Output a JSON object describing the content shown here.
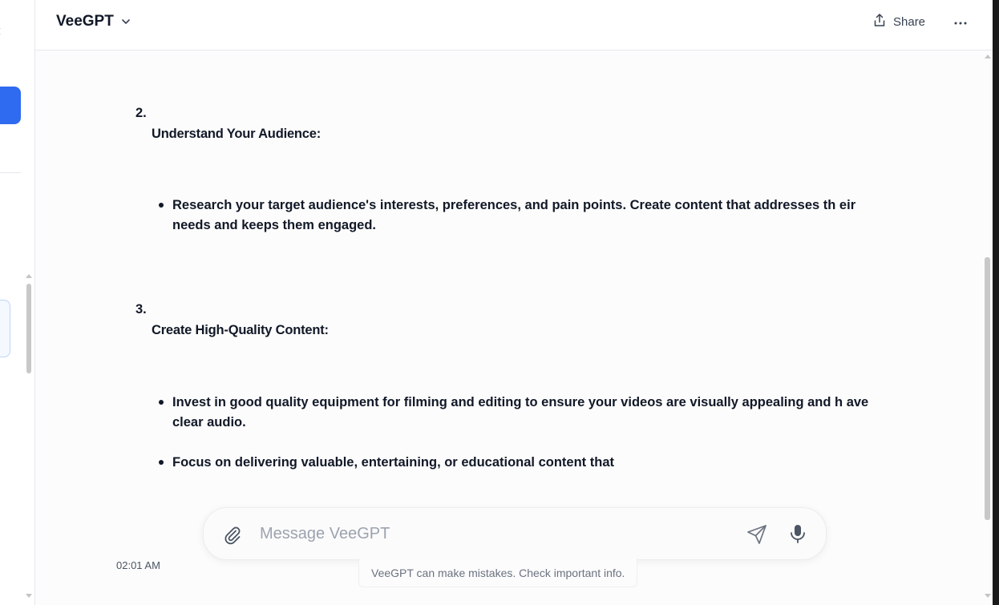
{
  "app": {
    "model_name": "VeeGPT"
  },
  "header": {
    "share_label": "Share"
  },
  "message": {
    "items": [
      {
        "number": "2.",
        "heading": "Understand Your Audience:",
        "bullets": [
          "Research your target audience's interests, preferences, and pain points. Create content that addresses th eir needs and keeps them engaged."
        ]
      },
      {
        "number": "3.",
        "heading": "Create High-Quality Content:",
        "bullets": [
          "Invest in good quality equipment for filming and editing to ensure your videos are visually appealing and h ave clear audio.",
          "Focus on delivering valuable, entertaining, or educational content that"
        ]
      }
    ],
    "timestamp": "02:01 AM"
  },
  "composer": {
    "placeholder": "Message VeeGPT",
    "value": ""
  },
  "footer": {
    "disclaimer": "VeeGPT can make mistakes. Check important info."
  },
  "colors": {
    "accent": "#2f6bf0",
    "text": "#111827",
    "muted": "#6b7280"
  }
}
